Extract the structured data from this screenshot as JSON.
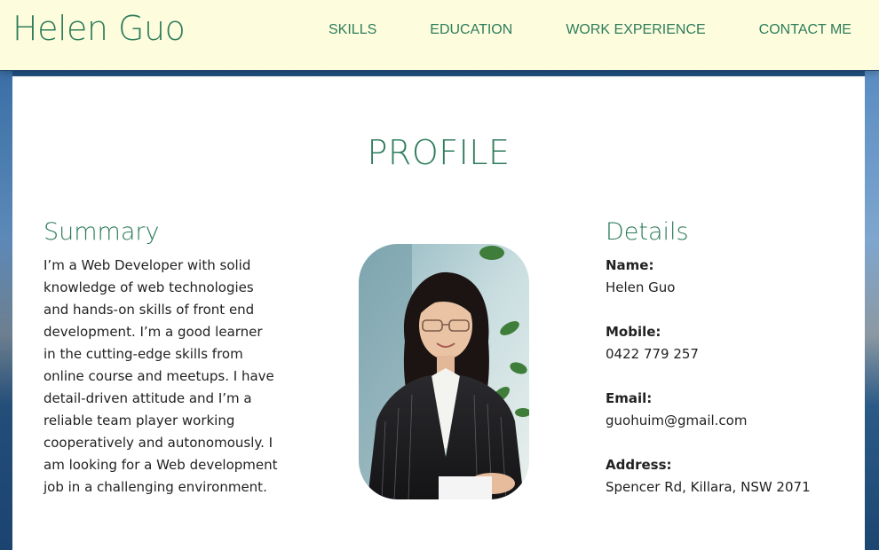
{
  "header": {
    "brand": "Helen Guo",
    "nav": [
      "SKILLS",
      "EDUCATION",
      "WORK EXPERIENCE",
      "CONTACT ME"
    ]
  },
  "profile": {
    "title": "PROFILE",
    "summary": {
      "heading": "Summary",
      "text": "I’m a Web Developer with solid knowledge of web technologies and hands-on skills of front end development. I’m a good learner in the cutting-edge skills from online course and meetups. I have detail-driven attitude and I’m a reliable team player working cooperatively and autonomously. I am looking for a Web development job in a challenging environment."
    },
    "details": {
      "heading": "Details",
      "items": [
        {
          "label": "Name:",
          "value": "Helen Guo"
        },
        {
          "label": "Mobile:",
          "value": "0422 779 257"
        },
        {
          "label": "Email:",
          "value": "guohuim@gmail.com"
        },
        {
          "label": "Address:",
          "value": "Spencer Rd, Killara, NSW 2071"
        }
      ]
    }
  },
  "colors": {
    "accent": "#2e7d5b",
    "header_bg": "#fdfdde",
    "text": "#222222"
  },
  "icons": {
    "photo": "profile-photo"
  }
}
